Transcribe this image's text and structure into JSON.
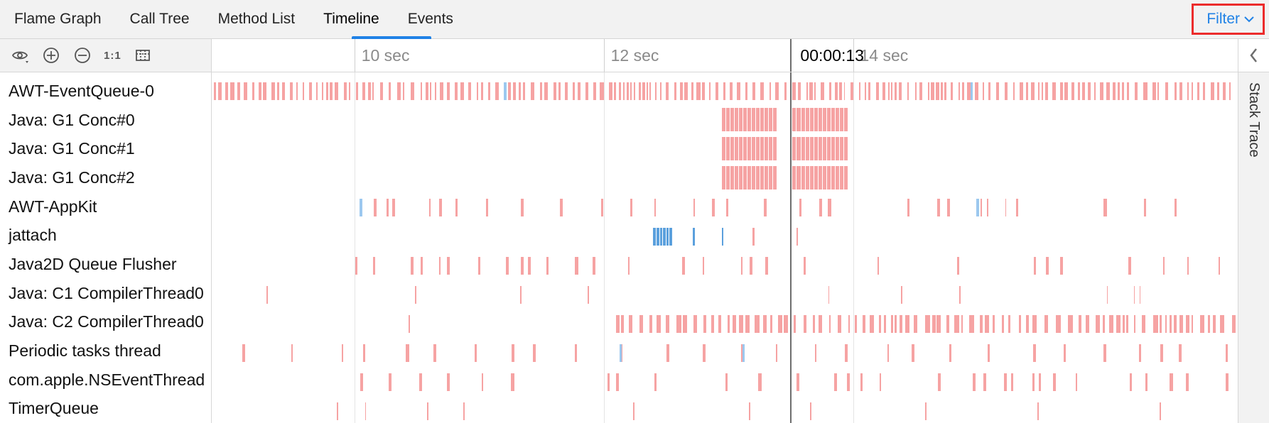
{
  "tabs": [
    "Flame Graph",
    "Call Tree",
    "Method List",
    "Timeline",
    "Events"
  ],
  "active_tab_index": 3,
  "filter_label": "Filter",
  "stack_trace_label": "Stack Trace",
  "ruler": {
    "ticks": [
      {
        "pos_pct": 13.9,
        "label": "10 sec"
      },
      {
        "pos_pct": 38.2,
        "label": "12 sec"
      },
      {
        "pos_pct": 62.5,
        "label": "14 sec"
      }
    ],
    "cursor_pct": 56.4,
    "cursor_label": "00:00:13"
  },
  "threads": [
    "AWT-EventQueue-0",
    "Java: G1 Conc#0",
    "Java: G1 Conc#1",
    "Java: G1 Conc#2",
    "AWT-AppKit",
    "jattach",
    "Java2D Queue Flusher",
    "Java: C1 CompilerThread0",
    "Java: C2 CompilerThread0",
    "Periodic tasks thread",
    "com.apple.NSEventThread",
    "TimerQueue"
  ],
  "chart_data": {
    "type": "timeline",
    "time_domain_sec": [
      8.85,
      17.1
    ],
    "cursor_sec": 13.5,
    "colors": {
      "red": "#f6a3a3",
      "blue": "#9cc8ef"
    },
    "rows": [
      {
        "name": "AWT-EventQueue-0",
        "pattern": "dense_red_full",
        "blue_spots_sec": [
          11.2,
          14.95
        ]
      },
      {
        "name": "Java: G1 Conc#0",
        "pattern": "solid_red_block",
        "block_sec": [
          12.95,
          13.95
        ]
      },
      {
        "name": "Java: G1 Conc#1",
        "pattern": "solid_red_block",
        "block_sec": [
          12.95,
          13.95
        ]
      },
      {
        "name": "Java: G1 Conc#2",
        "pattern": "solid_red_block",
        "block_sec": [
          12.95,
          13.95
        ]
      },
      {
        "name": "AWT-AppKit",
        "pattern": "sparse_red_mid_right",
        "blue_spots_sec": [
          10.04,
          15.0
        ]
      },
      {
        "name": "jattach",
        "pattern": "blue_cluster",
        "cluster_sec": [
          12.4,
          12.55
        ],
        "extra_blue_sec": [
          12.72,
          12.95
        ],
        "extra_red_sec": [
          13.2,
          13.55
        ]
      },
      {
        "name": "Java2D Queue Flusher",
        "pattern": "sparse_red_mid_right"
      },
      {
        "name": "Java: C1 CompilerThread0",
        "pattern": "very_sparse_red"
      },
      {
        "name": "Java: C2 CompilerThread0",
        "pattern": "dense_red_right_half",
        "start_sec": 12.1
      },
      {
        "name": "Periodic tasks thread",
        "pattern": "sparse_red_full",
        "blue_spots_sec": [
          12.13,
          13.12
        ]
      },
      {
        "name": "com.apple.NSEventThread",
        "pattern": "sparse_red_mid_right"
      },
      {
        "name": "TimerQueue",
        "pattern": "very_sparse_red"
      }
    ]
  }
}
